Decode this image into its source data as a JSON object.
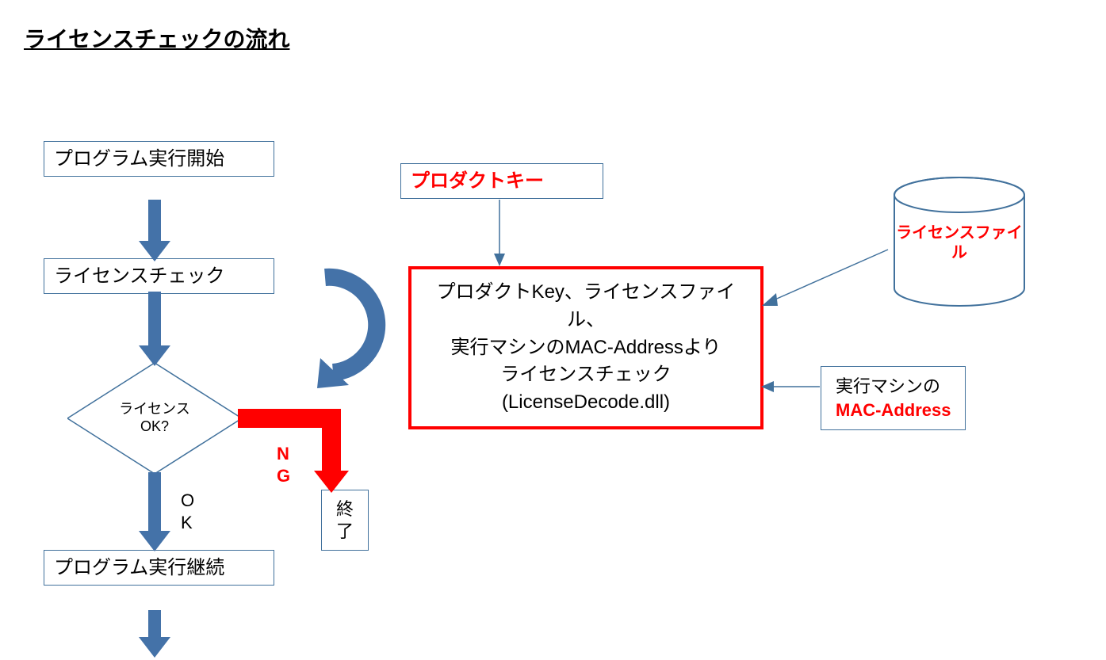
{
  "title": "ライセンスチェックの流れ",
  "flow": {
    "start": "プログラム実行開始",
    "check": "ライセンスチェック",
    "decision": "ライセンス\nOK?",
    "ok_label": "OK",
    "ng_label": "NG",
    "continue": "プログラム実行継続",
    "terminate": "終了"
  },
  "inputs": {
    "product_key_box": "プロダクトキー",
    "license_file_cyl": "ライセンスファイル",
    "mac_box_line1": "実行マシンの",
    "mac_box_line2": "MAC-Address"
  },
  "core": {
    "line1": "プロダクトKey、ライセンスファイル、",
    "line2": "実行マシンのMAC-Addressより",
    "line3": "ライセンスチェック",
    "line4": "(LicenseDecode.dll)"
  },
  "colors": {
    "blue": "#4472a8",
    "blue_border": "#41719c",
    "red": "#ff0000"
  }
}
